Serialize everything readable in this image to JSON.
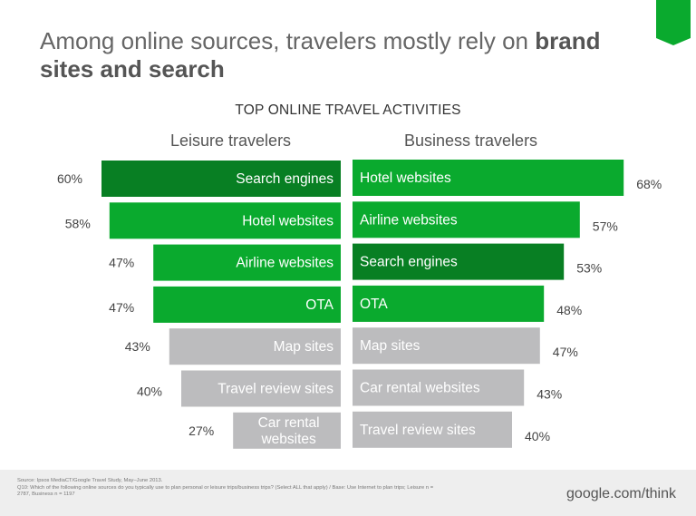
{
  "title": {
    "regular": "Among online sources, travelers mostly rely on ",
    "bold": "brand sites and search"
  },
  "colors": {
    "highlight": "#087f23",
    "bar": "#0aaa2e",
    "other": "#bcbcbe",
    "label_dark": "#444444",
    "footer_bg": "#eeeeee"
  },
  "chart_data": {
    "type": "bar",
    "orientation": "horizontal-butterfly",
    "title": "TOP ONLINE TRAVEL ACTIVITIES",
    "value_format": "{v}%",
    "panels": [
      {
        "name": "Leisure travelers",
        "direction": "left",
        "categories": [
          "Search engines",
          "Hotel websites",
          "Airline websites",
          "OTA",
          "Map sites",
          "Travel review sites",
          "Car rental websites"
        ],
        "values": [
          60,
          58,
          47,
          47,
          43,
          40,
          27
        ],
        "styles": [
          "highlight",
          "brand",
          "brand",
          "brand",
          "other",
          "other",
          "other"
        ]
      },
      {
        "name": "Business travelers",
        "direction": "right",
        "categories": [
          "Hotel websites",
          "Airline websites",
          "Search engines",
          "OTA",
          "Map sites",
          "Car rental websites",
          "Travel review sites"
        ],
        "values": [
          68,
          57,
          53,
          48,
          47,
          43,
          40
        ],
        "styles": [
          "brand",
          "brand",
          "highlight",
          "brand",
          "other",
          "other",
          "other"
        ]
      }
    ]
  },
  "footer": {
    "source_line1": "Source: Ipsos MediaCT/Google Travel Study, May–June 2013.",
    "source_line2": "Q10: Which of the following online sources do you typically use to plan personal or leisure trips/business trips? (Select ALL that apply) / Base: Use Internet to plan trips; Leisure n =",
    "source_line3": "2787, Business n = 1197",
    "brand": "google.com/think"
  }
}
